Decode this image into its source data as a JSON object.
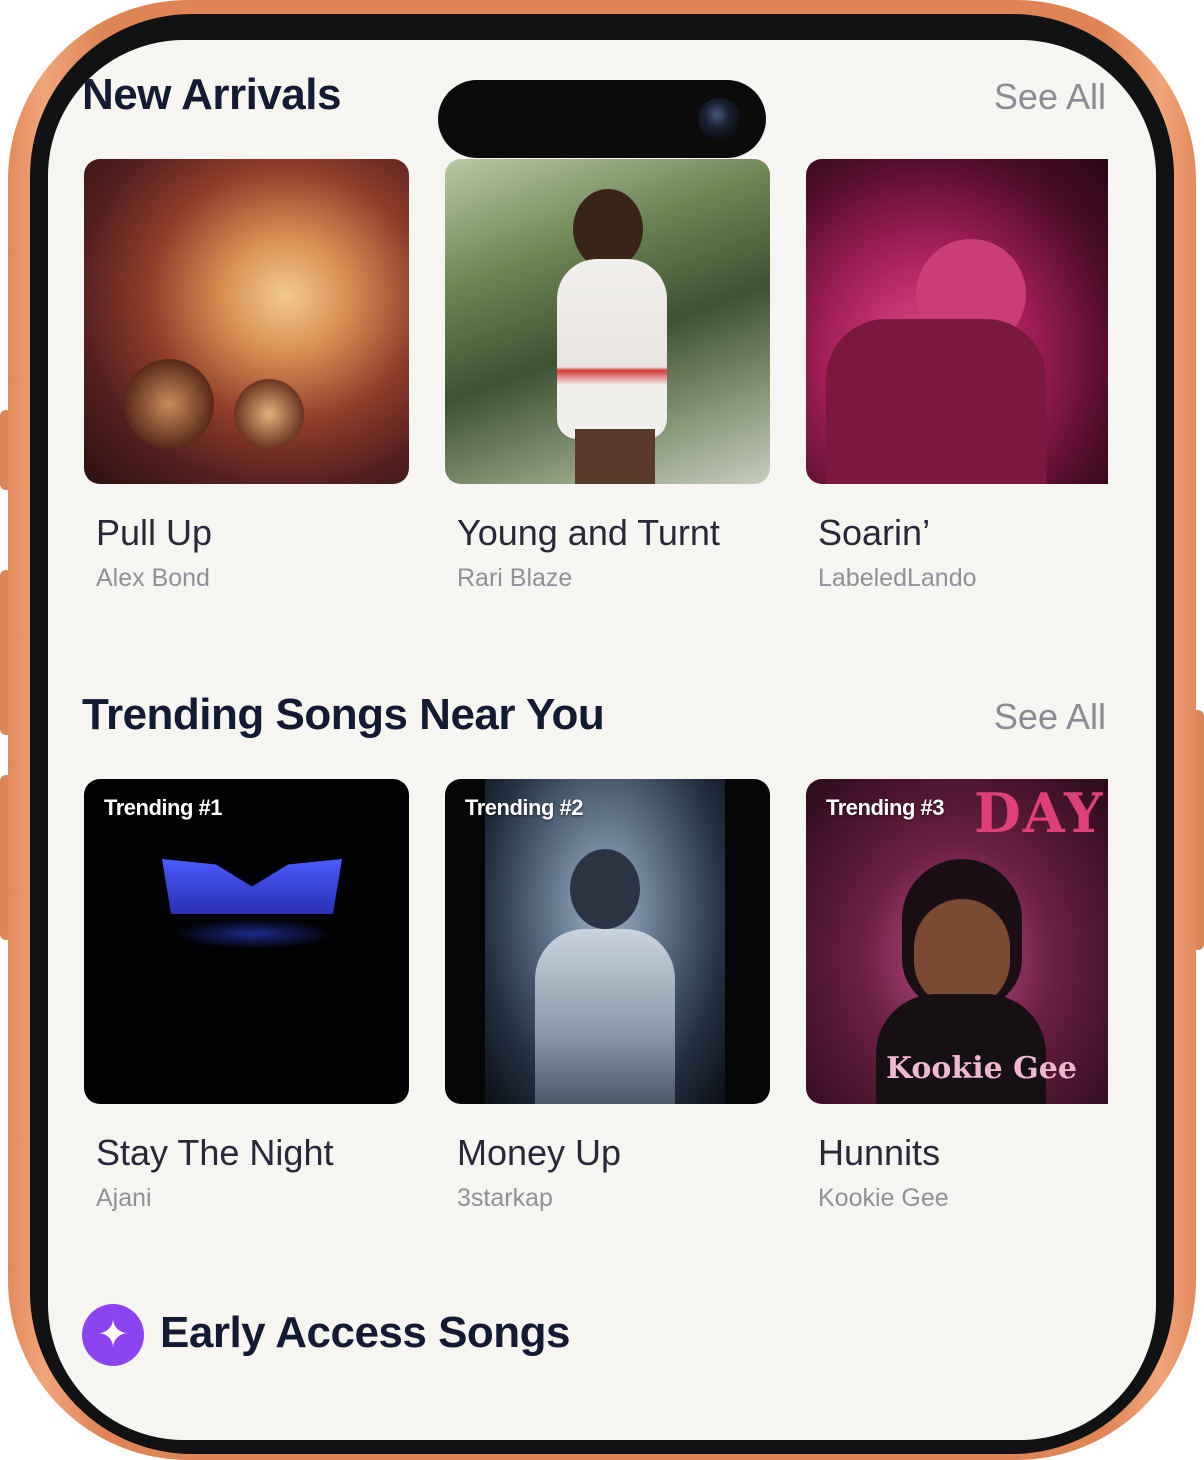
{
  "new_arrivals": {
    "title": "New Arrivals",
    "see_all": "See All",
    "items": [
      {
        "title": "Pull Up",
        "artist": "Alex Bond"
      },
      {
        "title": "Young and Turnt",
        "artist": "Rari Blaze"
      },
      {
        "title": "Soarin’",
        "artist": "LabeledLando"
      }
    ]
  },
  "trending": {
    "title": "Trending Songs Near You",
    "see_all": "See All",
    "items": [
      {
        "badge": "Trending #1",
        "title": "Stay The Night",
        "artist": "Ajani"
      },
      {
        "badge": "Trending #2",
        "title": "Money Up",
        "artist": "3starkap"
      },
      {
        "badge": "Trending #3",
        "title": "Hunnits",
        "artist": "Kookie Gee",
        "art_text_top": "DAY",
        "art_text_bottom": "Kookie Gee"
      }
    ]
  },
  "early_access": {
    "title": "Early Access Songs",
    "icon": "sparkle-icon"
  },
  "colors": {
    "frame": "#de8455",
    "screen_bg": "#f7f5f2",
    "heading": "#151a33",
    "muted": "#8a8c96",
    "accent_purple": "#8b44f0"
  }
}
